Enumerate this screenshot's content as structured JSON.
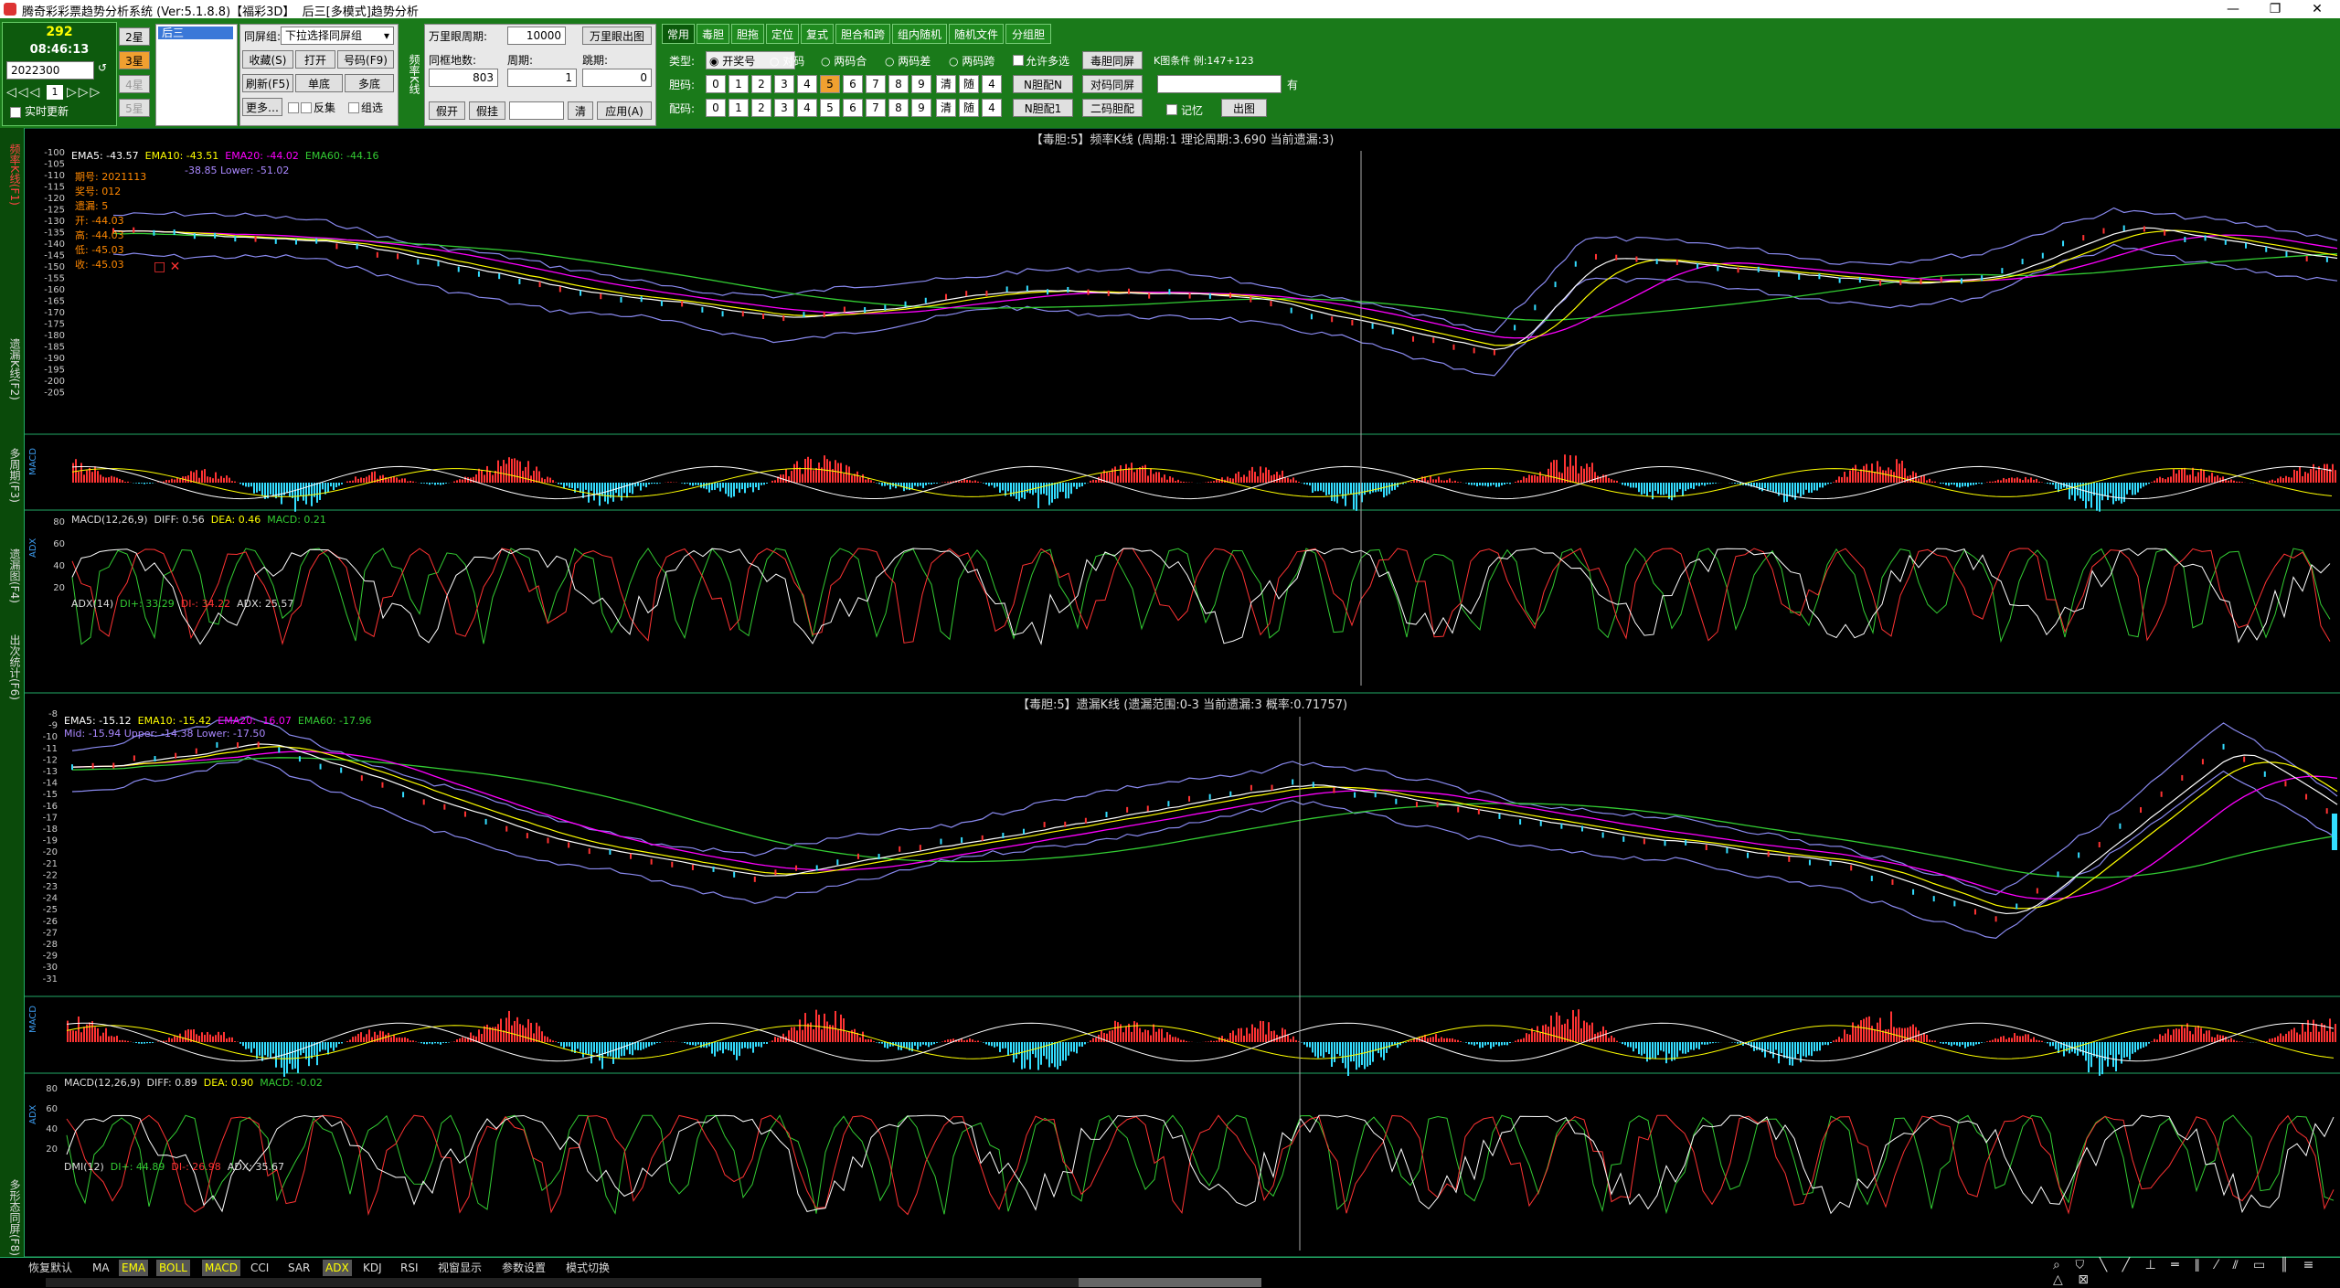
{
  "window": {
    "title": "腾奇彩彩票趋势分析系统 (Ver:5.1.8.8)【福彩3D】  后三[多模式]趋势分析",
    "min": "—",
    "max": "❐",
    "close": "✕"
  },
  "topleft": {
    "count": "292",
    "time": "08:46:13",
    "period": "2022300",
    "realtime": "实时更新",
    "play": "1"
  },
  "stars": [
    "2星",
    "3星",
    "4星",
    "5星"
  ],
  "group_list": [
    "后三"
  ],
  "group_select": {
    "label": "同屏组:",
    "value": "下拉选择同屏组"
  },
  "action_buttons": [
    "收藏(S)",
    "打开",
    "号码(F9)",
    "刷新(F5)",
    "单底",
    "多底",
    "更多…"
  ],
  "checks": {
    "reverse": "反集",
    "filter": "组选"
  },
  "freq_vert": "频率K线",
  "form": {
    "wan_label": "万里眼周期:",
    "wan_value": "10000",
    "wan_button": "万里眼出图",
    "same_label": "同框地数:",
    "same_value": "803",
    "period_label": "周期:",
    "period_value": "1",
    "skip_label": "跳期:",
    "skip_value": "0",
    "btns": [
      "假开",
      "假挂"
    ],
    "clear": "清",
    "apply": "应用(A)"
  },
  "tabs": [
    "常用",
    "毒胆",
    "胆拖",
    "定位",
    "复式",
    "胆合和跨",
    "组内随机",
    "随机文件",
    "分组胆"
  ],
  "type_label": "类型:",
  "types": [
    "开奖号",
    "对码",
    "两码合",
    "两码差",
    "两码跨"
  ],
  "allow_multi": "允许多选",
  "tongping": "毒胆同屏",
  "row_label1": "胆码:",
  "row_label2": "配码:",
  "digits": [
    "0",
    "1",
    "2",
    "3",
    "4",
    "5",
    "6",
    "7",
    "8",
    "9"
  ],
  "row_extra": [
    "清",
    "随",
    "4"
  ],
  "nbtns": [
    "N胆配N",
    "对码同屏",
    "N胆配1",
    "二码胆配"
  ],
  "condition_label": "K图条件",
  "condition_example": "例:147+123",
  "memo": "记忆",
  "draw_btn": "出图",
  "have": "有",
  "side_items": [
    "频率K线(F1)",
    "遗漏K线(F2)",
    "多周期(F3)",
    "遗漏图(F4)",
    "出次统计(F6)",
    "多形态同屏(F8)"
  ],
  "chart1": {
    "title": "【毒胆:5】频率K线 (周期:1 理论周期:3.690 当前遗漏:3)",
    "ema": [
      [
        "EMA5: -43.57",
        "#fff"
      ],
      [
        "EMA10: -43.51",
        "#ff0"
      ],
      [
        "EMA20: -44.02",
        "#f0f"
      ],
      [
        "EMA60: -44.16",
        "#3c3"
      ]
    ],
    "boll": "-38.85 Lower: -51.02",
    "info": [
      "期号: 2021113",
      "奖号: 012",
      "遗漏: 5",
      "开: -44.03",
      "高: -44.03",
      "低: -45.03",
      "收: -45.03"
    ],
    "yticks": [
      "-100",
      "-105",
      "-110",
      "-115",
      "-120",
      "-125",
      "-130",
      "-135",
      "-140",
      "-145",
      "-150",
      "-155",
      "-160",
      "-165",
      "-170",
      "-175",
      "-180",
      "-185",
      "-190",
      "-195",
      "-200",
      "-205"
    ]
  },
  "macd1": {
    "label": "MACD(12,26,9)",
    "diff": "DIFF: 0.56",
    "dea": "DEA: 0.46",
    "macd": "MACD: 0.21",
    "side": "MACD"
  },
  "adx1": {
    "label": "ADX(14)",
    "di_plus": "DI+: 33.29",
    "di_minus": "DI-: 34.22",
    "adx": "ADX: 25.57",
    "side": "ADX",
    "yticks": [
      "80",
      "60",
      "40",
      "20"
    ]
  },
  "chart2": {
    "title": "【毒胆:5】遗漏K线 (遗漏范围:0-3 当前遗漏:3 概率:0.71757)",
    "ema": [
      [
        "EMA5: -15.12",
        "#fff"
      ],
      [
        "EMA10: -15.42",
        "#ff0"
      ],
      [
        "EMA20: -16.07",
        "#f0f"
      ],
      [
        "EMA60: -17.96",
        "#3c3"
      ]
    ],
    "boll": "Mid: -15.94 Upper: -14.38 Lower: -17.50",
    "yticks": [
      "-8",
      "-9",
      "-10",
      "-11",
      "-12",
      "-13",
      "-14",
      "-15",
      "-16",
      "-17",
      "-18",
      "-19",
      "-20",
      "-21",
      "-22",
      "-23",
      "-24",
      "-25",
      "-26",
      "-27",
      "-28",
      "-29",
      "-30",
      "-31"
    ]
  },
  "macd2": {
    "label": "MACD(12,26,9)",
    "diff": "DIFF: 0.89",
    "dea": "DEA: 0.90",
    "macd": "MACD: -0.02",
    "side": "MACD"
  },
  "dmi2": {
    "label": "DMI(12)",
    "di_plus": "DI+: 44.89",
    "di_minus": "DI-: 26.98",
    "adx": "ADX: 35.67",
    "side": "ADX",
    "yticks": [
      "80",
      "60",
      "40",
      "20"
    ]
  },
  "status_items": [
    "恢复默认",
    "MA",
    "EMA",
    "BOLL",
    "MACD",
    "CCI",
    "SAR",
    "ADX",
    "KDJ",
    "RSI",
    "视窗显示",
    "参数设置",
    "模式切换"
  ],
  "status_on": [
    2,
    3,
    4,
    7
  ]
}
